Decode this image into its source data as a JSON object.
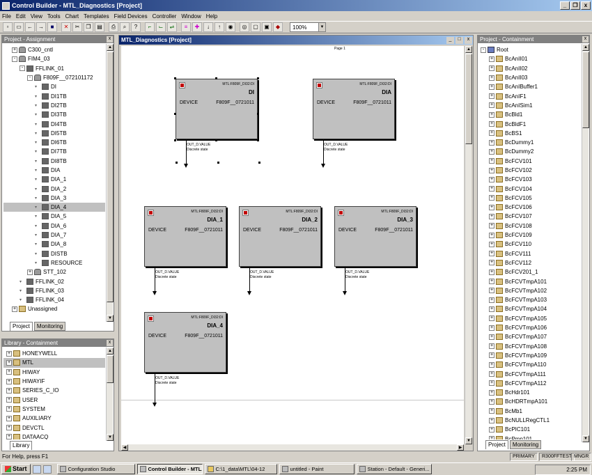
{
  "app": {
    "title": "Control Builder - MTL_Diagnostics [Project]"
  },
  "window_buttons": [
    "_",
    "❒",
    "x"
  ],
  "menu": [
    "File",
    "Edit",
    "View",
    "Tools",
    "Chart",
    "Templates",
    "Field Devices",
    "Controller",
    "Window",
    "Help"
  ],
  "toolbar": {
    "zoom": "100%"
  },
  "left_panel": {
    "title": "Project - Assignment",
    "tabs": [
      "Project",
      "Monitoring"
    ],
    "tree": [
      {
        "label": "C300_cntl",
        "indent": 1,
        "pm": "+",
        "icon": "dev"
      },
      {
        "label": "FIM4_03",
        "indent": 1,
        "pm": "-",
        "icon": "dev"
      },
      {
        "label": "FFLINK_01",
        "indent": 2,
        "pm": "-",
        "icon": "blk"
      },
      {
        "label": "F809F__072101172",
        "indent": 3,
        "pm": "-",
        "icon": "dev"
      },
      {
        "label": "DI",
        "indent": 4,
        "pm": "",
        "icon": "blk"
      },
      {
        "label": "DI1TB",
        "indent": 4,
        "pm": "",
        "icon": "blk"
      },
      {
        "label": "DI2TB",
        "indent": 4,
        "pm": "",
        "icon": "blk"
      },
      {
        "label": "DI3TB",
        "indent": 4,
        "pm": "",
        "icon": "blk"
      },
      {
        "label": "DI4TB",
        "indent": 4,
        "pm": "",
        "icon": "blk"
      },
      {
        "label": "DI5TB",
        "indent": 4,
        "pm": "",
        "icon": "blk"
      },
      {
        "label": "DI6TB",
        "indent": 4,
        "pm": "",
        "icon": "blk"
      },
      {
        "label": "DI7TB",
        "indent": 4,
        "pm": "",
        "icon": "blk"
      },
      {
        "label": "DI8TB",
        "indent": 4,
        "pm": "",
        "icon": "blk"
      },
      {
        "label": "DIA",
        "indent": 4,
        "pm": "",
        "icon": "blk"
      },
      {
        "label": "DIA_1",
        "indent": 4,
        "pm": "",
        "icon": "blk"
      },
      {
        "label": "DIA_2",
        "indent": 4,
        "pm": "",
        "icon": "blk"
      },
      {
        "label": "DIA_3",
        "indent": 4,
        "pm": "",
        "icon": "blk"
      },
      {
        "label": "DIA_4",
        "indent": 4,
        "pm": "",
        "icon": "blk",
        "selected": true
      },
      {
        "label": "DIA_5",
        "indent": 4,
        "pm": "",
        "icon": "blk"
      },
      {
        "label": "DIA_6",
        "indent": 4,
        "pm": "",
        "icon": "blk"
      },
      {
        "label": "DIA_7",
        "indent": 4,
        "pm": "",
        "icon": "blk"
      },
      {
        "label": "DIA_8",
        "indent": 4,
        "pm": "",
        "icon": "blk"
      },
      {
        "label": "DISTB",
        "indent": 4,
        "pm": "",
        "icon": "blk"
      },
      {
        "label": "RESOURCE",
        "indent": 4,
        "pm": "",
        "icon": "blk"
      },
      {
        "label": "STT_102",
        "indent": 3,
        "pm": "+",
        "icon": "dev"
      },
      {
        "label": "FFLINK_02",
        "indent": 2,
        "pm": "",
        "icon": "blk"
      },
      {
        "label": "FFLINK_03",
        "indent": 2,
        "pm": "",
        "icon": "blk"
      },
      {
        "label": "FFLINK_04",
        "indent": 2,
        "pm": "",
        "icon": "blk"
      },
      {
        "label": "Unassigned",
        "indent": 1,
        "pm": "+",
        "icon": "pic"
      }
    ]
  },
  "library_panel": {
    "title": "Library - Containment",
    "tabs": [
      "Library"
    ],
    "tree": [
      {
        "label": "HONEYWELL"
      },
      {
        "label": "MTL",
        "selected": true
      },
      {
        "label": "HIWAY"
      },
      {
        "label": "HIWAYIF"
      },
      {
        "label": "SERIES_C_IO"
      },
      {
        "label": "USER"
      },
      {
        "label": "SYSTEM"
      },
      {
        "label": "AUXILIARY"
      },
      {
        "label": "DEVCTL"
      },
      {
        "label": "DATAACQ"
      }
    ]
  },
  "chart_window": {
    "title": "MTL_Diagnostics [Project]",
    "page_label": "Page 1",
    "blocks": [
      {
        "name": "DI",
        "class": "MTL:F809F_DI32:DI",
        "device_label": "DEVICE",
        "device": "F809F__0721011",
        "out": "OUT_D.VALUE",
        "out2": "Discrete state"
      },
      {
        "name": "DIA",
        "class": "MTL:F809F_DI32:DI",
        "device_label": "DEVICE",
        "device": "F809F__0721011",
        "out": "OUT_D.VALUE",
        "out2": "Discrete state"
      },
      {
        "name": "DIA_1",
        "class": "MTL:F809F_DI32:DI",
        "device_label": "DEVICE",
        "device": "F809F__0721011",
        "out": "OUT_D.VALUE",
        "out2": "Discrete state"
      },
      {
        "name": "DIA_2",
        "class": "MTL:F809F_DI32:DI",
        "device_label": "DEVICE",
        "device": "F809F__0721011",
        "out": "OUT_D.VALUE",
        "out2": "Discrete state"
      },
      {
        "name": "DIA_3",
        "class": "MTL:F809F_DI32:DI",
        "device_label": "DEVICE",
        "device": "F809F__0721011",
        "out": "OUT_D.VALUE",
        "out2": "Discrete state"
      },
      {
        "name": "DIA_4",
        "class": "MTL:F809F_DI32:DI",
        "device_label": "DEVICE",
        "device": "F809F__0721011",
        "out": "OUT_D.VALUE",
        "out2": "Discrete state"
      }
    ]
  },
  "right_panel": {
    "title": "Project - Containment",
    "tabs": [
      "Project",
      "Monitoring"
    ],
    "root": "Root",
    "items": [
      "BcAnII01",
      "BcAnII02",
      "BcAnII03",
      "BcAnIBuffer1",
      "BcAnIF1",
      "BcAnISim1",
      "BcBld1",
      "BcBldF1",
      "BcBS1",
      "BcDummy1",
      "BcDummy2",
      "BcFCV101",
      "BcFCV102",
      "BcFCV103",
      "BcFCV104",
      "BcFCV105",
      "BcFCV106",
      "BcFCV107",
      "BcFCV108",
      "BcFCV109",
      "BcFCV110",
      "BcFCV111",
      "BcFCV112",
      "BcFCV201_1",
      "BcFCVTmpA101",
      "BcFCVTmpA102",
      "BcFCVTmpA103",
      "BcFCVTmpA104",
      "BcFCVTmpA105",
      "BcFCVTmpA106",
      "BcFCVTmpA107",
      "BcFCVTmpA108",
      "BcFCVTmpA109",
      "BcFCVTmpA110",
      "BcFCVTmpA111",
      "BcFCVTmpA112",
      "BcHdr101",
      "BcHDRTmpA101",
      "BcMb1",
      "BcNULLRegCTL1",
      "BcPIC101",
      "BcPmp101"
    ]
  },
  "status": {
    "help": "For Help, press F1",
    "mode": "PRIMARY",
    "server": "R300FFTEST",
    "user": "MNGR"
  },
  "taskbar": {
    "start": "Start",
    "tasks": [
      "Configuration Studio",
      "Control Builder - MTL...",
      "C:\\1_data\\MTL\\04-12",
      "untitled - Paint",
      "Station - Default - Generi..."
    ],
    "active_task": 1,
    "clock": "2:25 PM"
  }
}
